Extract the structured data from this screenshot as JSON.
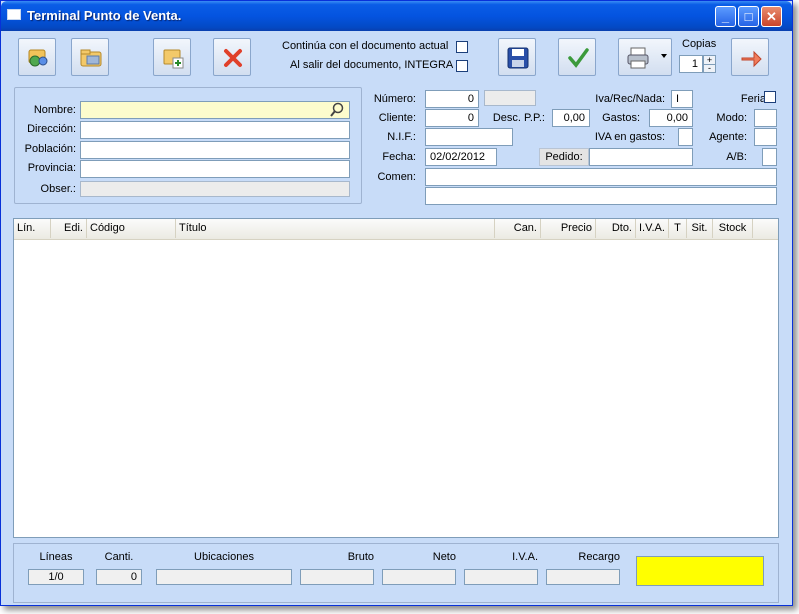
{
  "window": {
    "title": "Terminal Punto de Venta."
  },
  "toolbar": {
    "option1_label": "Continúa con el documento actual",
    "option2_label": "Al salir del documento, INTEGRA",
    "copies_label": "Copias",
    "copies_value": "1"
  },
  "customer": {
    "nombre_label": "Nombre:",
    "nombre_value": "",
    "direccion_label": "Dirección:",
    "poblacion_label": "Población:",
    "provincia_label": "Provincia:",
    "obser_label": "Obser.:"
  },
  "document": {
    "numero_label": "Número:",
    "numero_value": "0",
    "cliente_label": "Cliente:",
    "cliente_value": "0",
    "desc_pp_label": "Desc. P.P.:",
    "desc_pp_value": "0,00",
    "gastos_label": "Gastos:",
    "gastos_value": "0,00",
    "nif_label": "N.I.F.:",
    "iva_gastos_label": "IVA en gastos:",
    "fecha_label": "Fecha:",
    "fecha_value": "02/02/2012",
    "pedido_label": "Pedido:",
    "comen_label": "Comen:",
    "iva_rec_label": "Iva/Rec/Nada:",
    "iva_rec_value": "I",
    "feria_label": "Feria:",
    "modo_label": "Modo:",
    "agente_label": "Agente:",
    "ab_label": "A/B:"
  },
  "grid": {
    "columns": [
      "Lín.",
      "Edi.",
      "Código",
      "Título",
      "Can.",
      "Precio",
      "Dto.",
      "I.V.A.",
      "T",
      "Sit.",
      "Stock"
    ],
    "rows": []
  },
  "footer": {
    "lineas_label": "Líneas",
    "lineas_value": "1/0",
    "canti_label": "Canti.",
    "canti_value": "0",
    "ubicaciones_label": "Ubicaciones",
    "bruto_label": "Bruto",
    "neto_label": "Neto",
    "iva_label": "I.V.A.",
    "recargo_label": "Recargo"
  },
  "colors": {
    "background": "#c8dcf8",
    "titlebar": "#0454e0",
    "total_display": "#ffff00",
    "name_field": "#fdfccd"
  },
  "icons": [
    "search-client-icon",
    "folder-icon",
    "new-document-icon",
    "delete-icon",
    "save-icon",
    "accept-check-icon",
    "printer-icon",
    "exit-arrow-icon",
    "magnifier-icon"
  ]
}
